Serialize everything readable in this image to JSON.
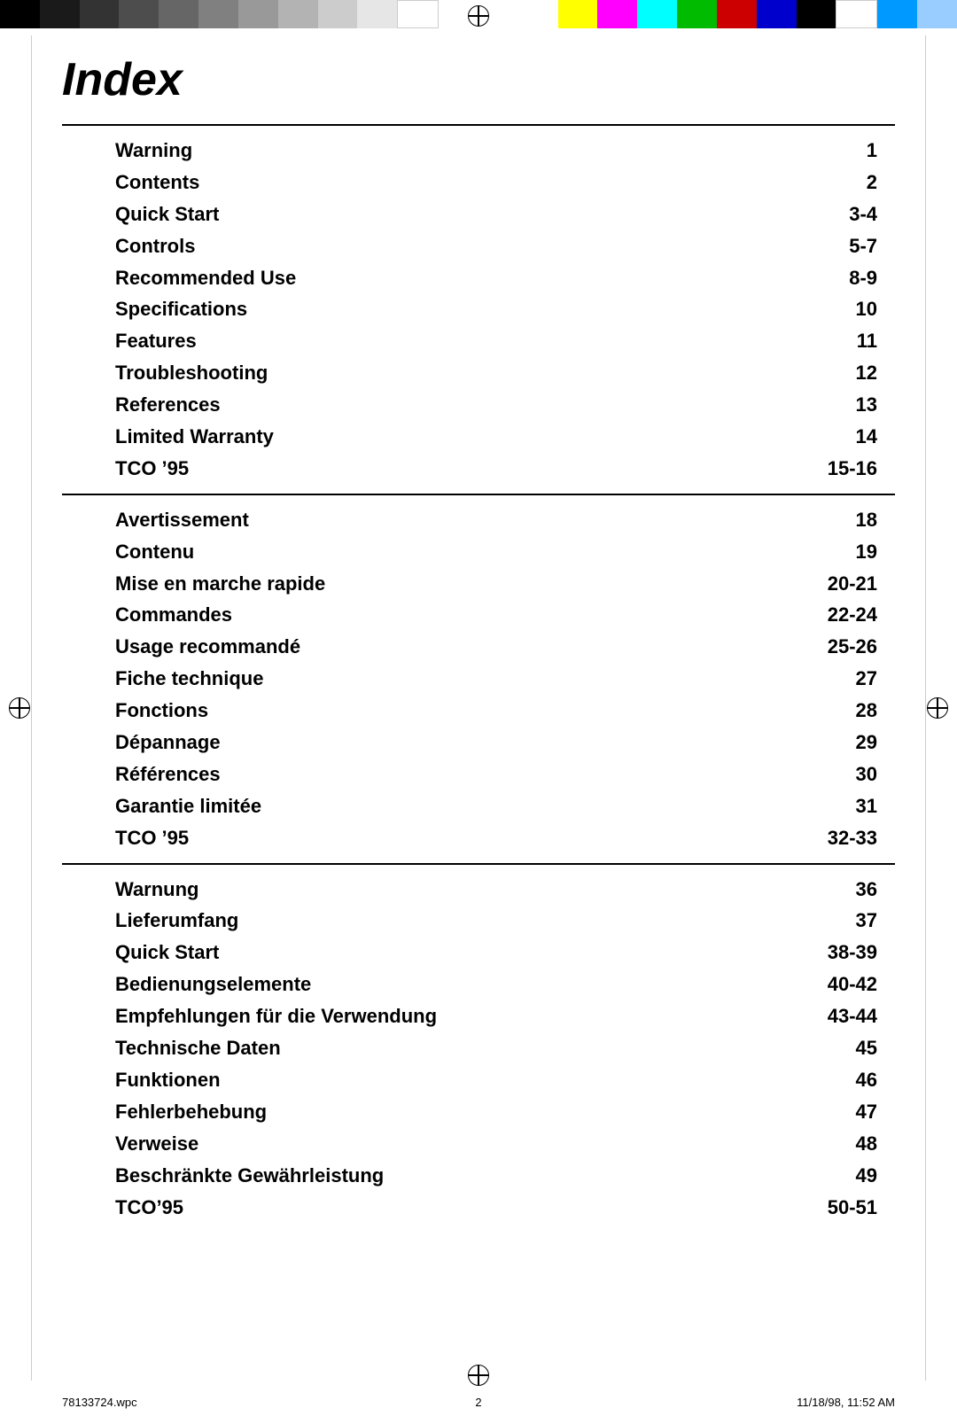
{
  "page": {
    "title": "Index",
    "footer_left": "78133724.wpc",
    "footer_center": "2",
    "footer_right": "11/18/98, 11:52 AM"
  },
  "top_bar": {
    "colors": [
      "#1a1a1a",
      "#2d2d2d",
      "#404040",
      "#595959",
      "#737373",
      "#8c8c8c",
      "#a6a6a6",
      "#bfbfbf",
      "#d9d9d9",
      "#f2f2f2",
      "#ffffff",
      "#ffff00",
      "#ff00ff",
      "#00ffff",
      "#00cc00",
      "#ff0000",
      "#000000",
      "#ffffff",
      "#00ccff",
      "#99ccff"
    ]
  },
  "sections": [
    {
      "id": "english",
      "rows": [
        {
          "label": "Warning",
          "page": "1"
        },
        {
          "label": "Contents",
          "page": "2"
        },
        {
          "label": "Quick Start",
          "page": "3-4"
        },
        {
          "label": "Controls",
          "page": "5-7"
        },
        {
          "label": "Recommended Use",
          "page": "8-9"
        },
        {
          "label": "Specifications",
          "page": "10"
        },
        {
          "label": "Features",
          "page": "11"
        },
        {
          "label": "Troubleshooting",
          "page": "12"
        },
        {
          "label": "References",
          "page": "13"
        },
        {
          "label": "Limited Warranty",
          "page": "14"
        },
        {
          "label": "TCO ’95",
          "page": "15-16"
        }
      ]
    },
    {
      "id": "french",
      "rows": [
        {
          "label": "Avertissement",
          "page": "18"
        },
        {
          "label": "Contenu",
          "page": "19"
        },
        {
          "label": "Mise en marche rapide",
          "page": "20-21"
        },
        {
          "label": "Commandes",
          "page": "22-24"
        },
        {
          "label": "Usage recommandé",
          "page": "25-26"
        },
        {
          "label": "Fiche technique",
          "page": "27"
        },
        {
          "label": "Fonctions",
          "page": "28"
        },
        {
          "label": "Dépannage",
          "page": "29"
        },
        {
          "label": "Références",
          "page": "30"
        },
        {
          "label": "Garantie limitée",
          "page": "31"
        },
        {
          "label": "TCO ’95",
          "page": "32-33"
        }
      ]
    },
    {
      "id": "german",
      "rows": [
        {
          "label": "Warnung",
          "page": "36"
        },
        {
          "label": "Lieferumfang",
          "page": "37"
        },
        {
          "label": "Quick Start",
          "page": "38-39"
        },
        {
          "label": "Bedienungselemente",
          "page": "40-42"
        },
        {
          "label": "Empfehlungen für die Verwendung",
          "page": "43-44"
        },
        {
          "label": "Technische Daten",
          "page": "45"
        },
        {
          "label": "Funktionen",
          "page": "46"
        },
        {
          "label": "Fehlerbehebung",
          "page": "47"
        },
        {
          "label": "Verweise",
          "page": "48"
        },
        {
          "label": "Beschränkte Gewährleistung",
          "page": "49"
        },
        {
          "label": "TCO’95",
          "page": "50-51"
        }
      ]
    }
  ]
}
